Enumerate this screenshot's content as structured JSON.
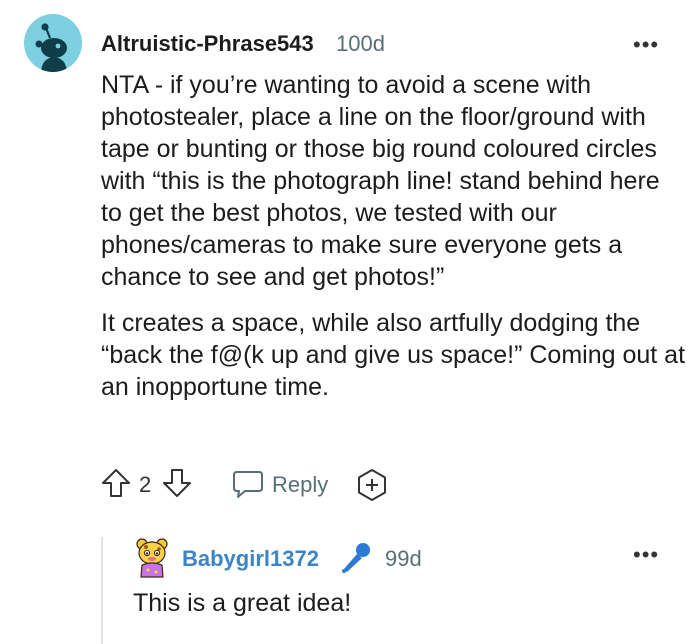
{
  "comment": {
    "username": "Altruistic-Phrase543",
    "age": "100d",
    "more_label": "•••",
    "paragraphs": [
      "NTA - if you’re wanting to avoid a scene with photostealer, place a line on the floor/ground with tape or bunting or those big round coloured circles with “this is the photograph line! stand behind here to get the best photos, we tested with our phones/cameras to make sure everyone gets a chance to see and get photos!”",
      "It creates a space, while also artfully dodging the “back the f@(k up and give us space!” Coming out at an inopportune time."
    ],
    "vote_count": "2",
    "reply_label": "Reply",
    "upvote_icon": "arrow-up-outline-icon",
    "downvote_icon": "arrow-down-outline-icon",
    "reply_icon": "speech-bubble-icon",
    "award_icon": "plus-hexagon-icon",
    "avatar_icon": "snoo-avatar-icon"
  },
  "reply": {
    "username": "Babygirl1372",
    "age": "99d",
    "more_label": "•••",
    "text": "This is a great idea!",
    "flair_icon": "microphone-icon",
    "avatar_icon": "cartoon-avatar-icon"
  },
  "colors": {
    "avatar_bg": "#7ed0e0",
    "reply_username": "#3d84c6",
    "muted": "#576f76",
    "text": "#1c1c1c",
    "thread_line": "#dfe3e6"
  }
}
